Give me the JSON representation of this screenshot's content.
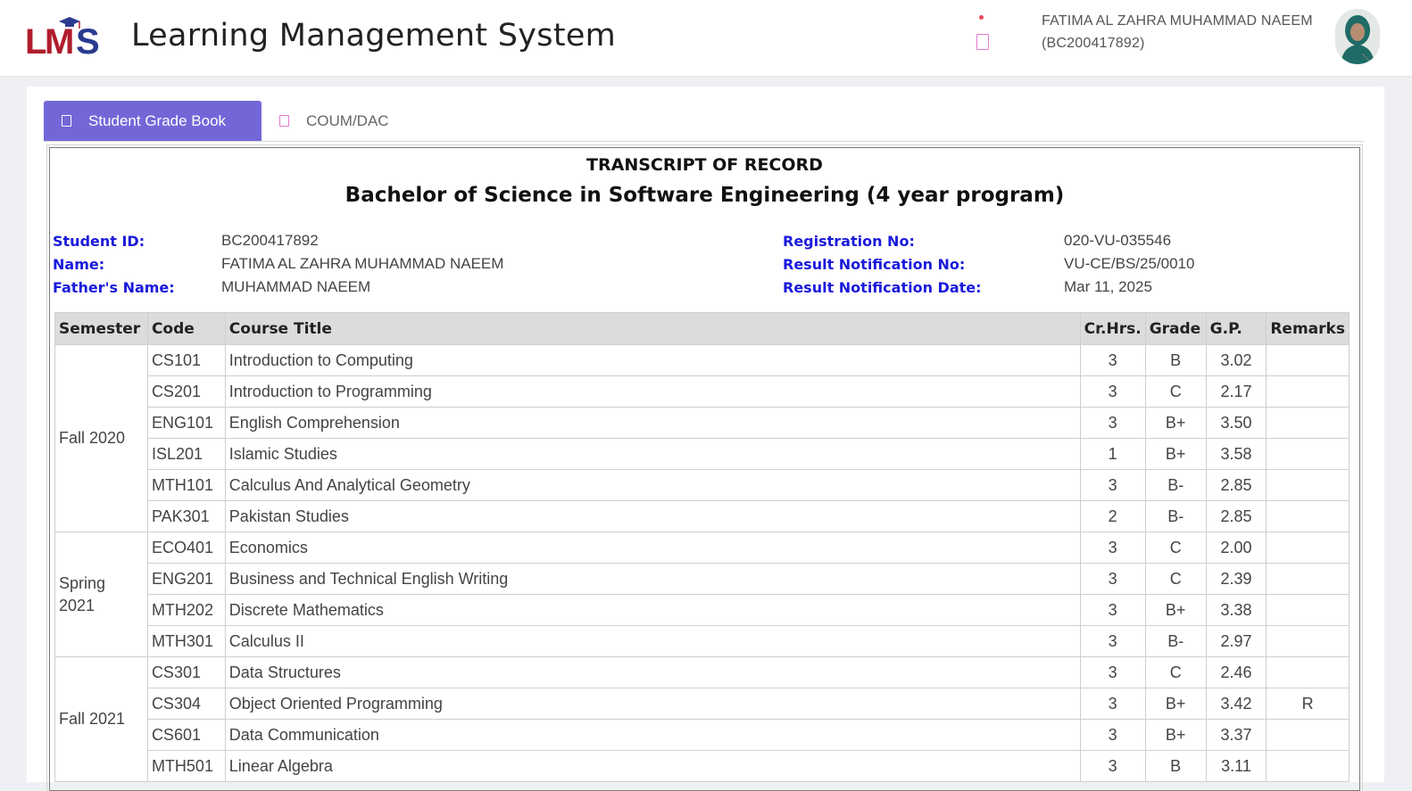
{
  "header": {
    "logo_text": "LMS",
    "app_title": "Learning Management System",
    "user_name": "FATIMA AL ZAHRA MUHAMMAD NAEEM",
    "user_id": "(BC200417892)"
  },
  "tabs": [
    {
      "label": "Student Grade Book",
      "active": true
    },
    {
      "label": "COUM/DAC",
      "active": false
    }
  ],
  "transcript": {
    "title": "TRANSCRIPT OF RECORD",
    "program": "Bachelor of Science in Software Engineering (4 year program)",
    "student_id_label": "Student ID:",
    "student_id": "BC200417892",
    "name_label": "Name:",
    "name": "FATIMA AL ZAHRA MUHAMMAD NAEEM",
    "father_label": "Father's Name:",
    "father": "MUHAMMAD NAEEM",
    "reg_label": "Registration No:",
    "reg_no": "020-VU-035546",
    "notif_no_label": "Result Notification No:",
    "notif_no": "VU-CE/BS/25/0010",
    "notif_date_label": "Result Notification Date:",
    "notif_date": "Mar 11, 2025"
  },
  "table": {
    "headers": [
      "Semester",
      "Code",
      "Course Title",
      "Cr.Hrs.",
      "Grade",
      "G.P.",
      "Remarks"
    ],
    "semesters": [
      {
        "name": "Fall 2020",
        "rows": [
          {
            "code": "CS101",
            "title": "Introduction to Computing",
            "cr": "3",
            "grade": "B",
            "gp": "3.02",
            "remarks": ""
          },
          {
            "code": "CS201",
            "title": "Introduction to Programming",
            "cr": "3",
            "grade": "C",
            "gp": "2.17",
            "remarks": ""
          },
          {
            "code": "ENG101",
            "title": "English Comprehension",
            "cr": "3",
            "grade": "B+",
            "gp": "3.50",
            "remarks": ""
          },
          {
            "code": "ISL201",
            "title": "Islamic Studies",
            "cr": "1",
            "grade": "B+",
            "gp": "3.58",
            "remarks": ""
          },
          {
            "code": "MTH101",
            "title": "Calculus And Analytical Geometry",
            "cr": "3",
            "grade": "B-",
            "gp": "2.85",
            "remarks": ""
          },
          {
            "code": "PAK301",
            "title": "Pakistan Studies",
            "cr": "2",
            "grade": "B-",
            "gp": "2.85",
            "remarks": ""
          }
        ]
      },
      {
        "name": "Spring 2021",
        "rows": [
          {
            "code": "ECO401",
            "title": "Economics",
            "cr": "3",
            "grade": "C",
            "gp": "2.00",
            "remarks": ""
          },
          {
            "code": "ENG201",
            "title": "Business and Technical English Writing",
            "cr": "3",
            "grade": "C",
            "gp": "2.39",
            "remarks": ""
          },
          {
            "code": "MTH202",
            "title": "Discrete Mathematics",
            "cr": "3",
            "grade": "B+",
            "gp": "3.38",
            "remarks": ""
          },
          {
            "code": "MTH301",
            "title": "Calculus II",
            "cr": "3",
            "grade": "B-",
            "gp": "2.97",
            "remarks": ""
          }
        ]
      },
      {
        "name": "Fall 2021",
        "rows": [
          {
            "code": "CS301",
            "title": "Data Structures",
            "cr": "3",
            "grade": "C",
            "gp": "2.46",
            "remarks": ""
          },
          {
            "code": "CS304",
            "title": "Object Oriented Programming",
            "cr": "3",
            "grade": "B+",
            "gp": "3.42",
            "remarks": "R"
          },
          {
            "code": "CS601",
            "title": "Data Communication",
            "cr": "3",
            "grade": "B+",
            "gp": "3.37",
            "remarks": ""
          },
          {
            "code": "MTH501",
            "title": "Linear Algebra",
            "cr": "3",
            "grade": "B",
            "gp": "3.11",
            "remarks": ""
          }
        ]
      }
    ]
  }
}
